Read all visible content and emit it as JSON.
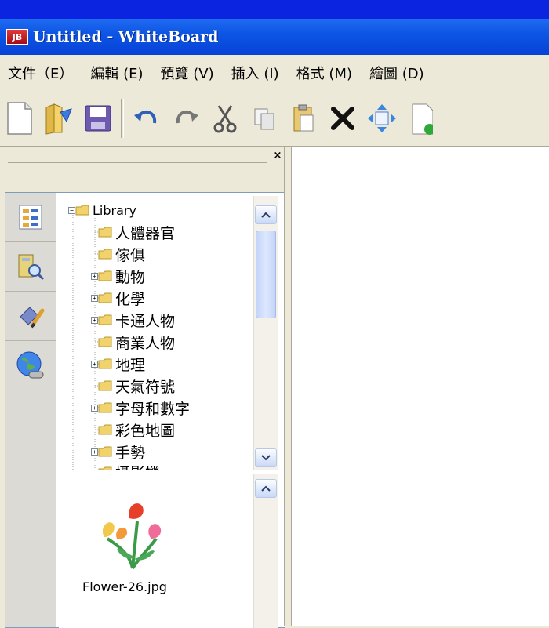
{
  "window": {
    "icon_text": "JB",
    "title": "Untitled - WhiteBoard"
  },
  "menu": [
    {
      "label": "文件（E）"
    },
    {
      "label": "編輯 (E)"
    },
    {
      "label": "預覽 (V)"
    },
    {
      "label": "插入 (I)"
    },
    {
      "label": "格式 (M)"
    },
    {
      "label": "繪圖 (D)"
    }
  ],
  "toolbar": {
    "buttons": [
      "new-document-icon",
      "open-folder-icon",
      "save-icon",
      "undo-icon",
      "redo-icon",
      "cut-icon",
      "copy-icon",
      "paste-icon",
      "delete-icon",
      "move-icon",
      "new-page-icon"
    ]
  },
  "panel": {
    "close_glyph": "×",
    "sidetabs": [
      "library-list-icon",
      "gallery-search-icon",
      "paint-tools-icon",
      "web-link-icon"
    ]
  },
  "tree": {
    "root": "Library",
    "items": [
      {
        "label": "人體器官",
        "expandable": false
      },
      {
        "label": "傢俱",
        "expandable": false
      },
      {
        "label": "動物",
        "expandable": true
      },
      {
        "label": "化學",
        "expandable": true
      },
      {
        "label": "卡通人物",
        "expandable": true
      },
      {
        "label": "商業人物",
        "expandable": false
      },
      {
        "label": "地理",
        "expandable": true
      },
      {
        "label": "天氣符號",
        "expandable": false
      },
      {
        "label": "字母和數字",
        "expandable": true
      },
      {
        "label": "彩色地圖",
        "expandable": false
      },
      {
        "label": "手勢",
        "expandable": true
      },
      {
        "label": "攝影機",
        "expandable": false
      }
    ]
  },
  "preview": {
    "caption": "Flower-26.jpg"
  },
  "colors": {
    "titlebar": "#0d56e6",
    "window_bg": "#ece9d8",
    "folder": "#f2d36b"
  }
}
